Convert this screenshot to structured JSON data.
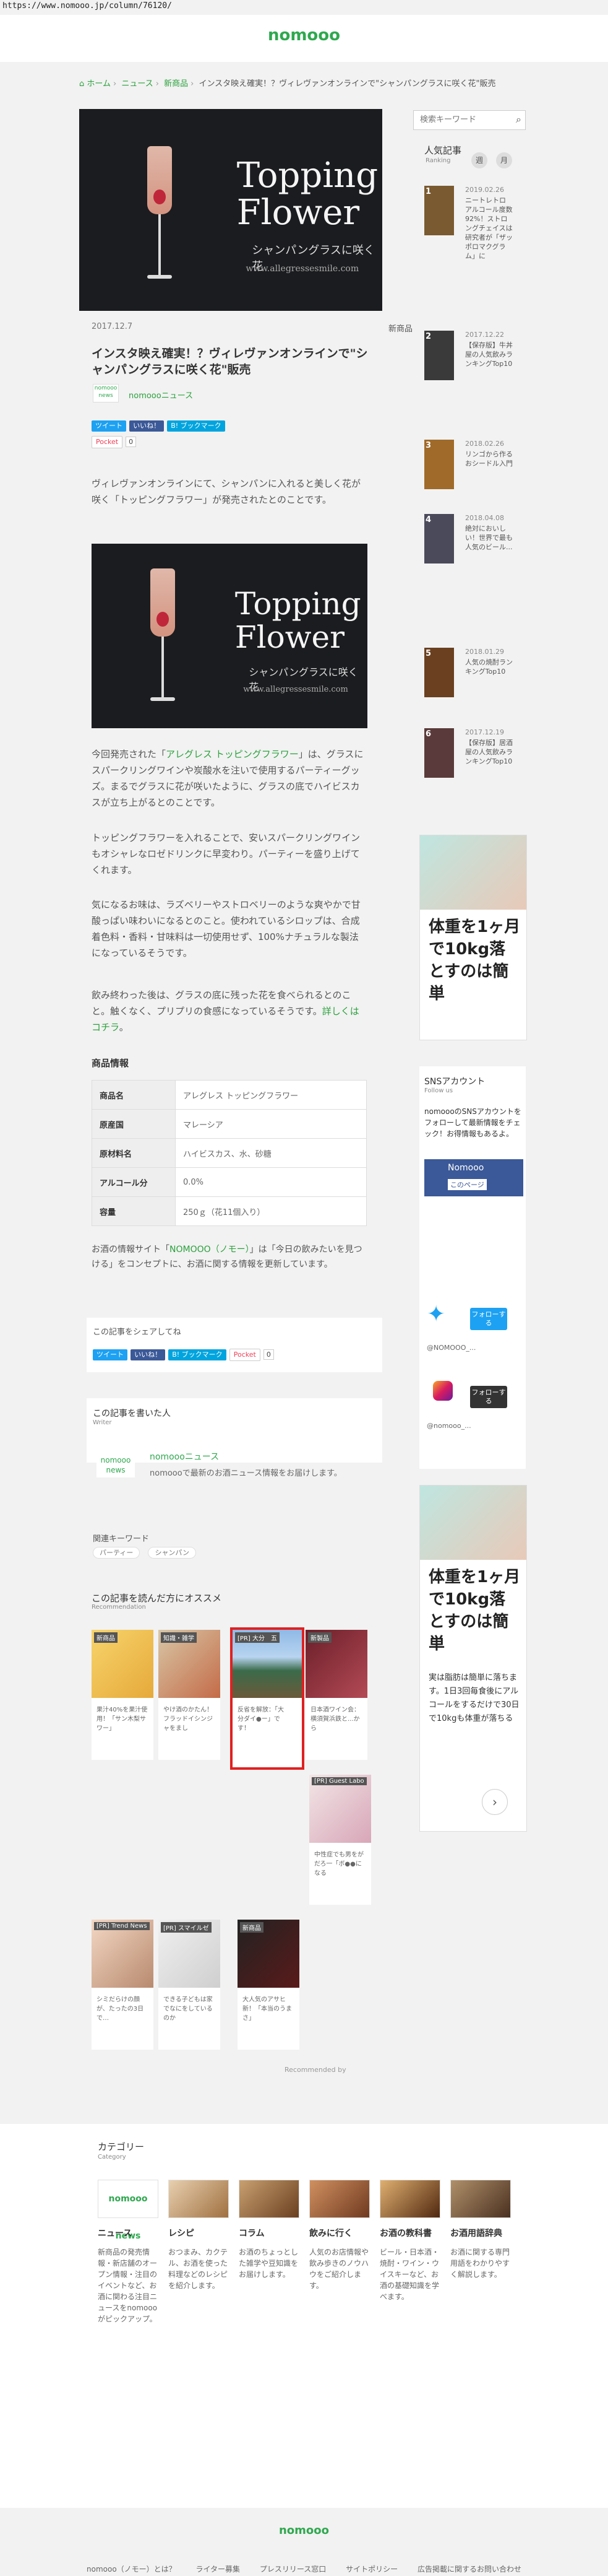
{
  "url": "https://www.nomooo.jp/column/76120/",
  "site": {
    "logo": "nomooo"
  },
  "breadcrumb": {
    "home": "ホーム",
    "news": "ニュース",
    "new": "新商品",
    "current": "インスタ映え確実！？ヴィレヴァンオンラインで\"シャンパングラスに咲く花\"販売"
  },
  "hero": {
    "title_line1": "Topping",
    "title_line2": "Flower",
    "subtitle": "シャンパングラスに咲く花",
    "watermark": "www.allegressesmile.com"
  },
  "article": {
    "date": "2017.12.7",
    "tag": "新商品",
    "title": "インスタ映え確実！？ヴィレヴァンオンラインで\"シャンパングラスに咲く花\"販売",
    "author": "nomoooニュース",
    "author_logo": "nomooo news",
    "lead": "ヴィレヴァンオンラインにて、シャンパンに入れると美しく花が咲く「トッピングフラワー」が発売されたとのことです。",
    "body1_pre": "今回発売された「",
    "body1_link": "アレグレス トッピングフラワー",
    "body1_post": "」は、グラスにスパークリングワインや炭酸水を注いで使用するパーティーグッズ。まるでグラスに花が咲いたように、グラスの底でハイビスカスが立ち上がるとのことです。",
    "body2": "トッピングフラワーを入れることで、安いスパークリングワインもオシャレなロゼドリンクに早変わり。パーティーを盛り上げてくれます。",
    "body3": "気になるお味は、ラズベリーやストロベリーのような爽やかで甘酸っぱい味わいになるとのこと。使われているシロップは、合成着色料・香料・甘味料は一切使用せず、100%ナチュラルな製法になっているそうです。",
    "body4_pre": "飲み終わった後は、グラスの底に残った花を食べられるとのこと。触くなく、プリプリの食感になっているそうです。",
    "body4_link": "詳しくはコチラ",
    "body4_post": "。"
  },
  "share": {
    "tweet": "ツイート",
    "like": "いいね！",
    "hatena": "B! ブックマーク",
    "pocket": "Pocket",
    "pocket_count": "0"
  },
  "product": {
    "heading": "商品情報",
    "rows": [
      {
        "key": "商品名",
        "value": "アレグレス トッピングフラワー"
      },
      {
        "key": "原産国",
        "value": "マレーシア"
      },
      {
        "key": "原材料名",
        "value": "ハイビスカス、水、砂糖"
      },
      {
        "key": "アルコール分",
        "value": "0.0%"
      },
      {
        "key": "容量",
        "value": "250ｇ（花11個入り）"
      }
    ]
  },
  "closing": {
    "pre": "お酒の情報サイト「",
    "link": "NOMOOO（ノモー）",
    "post": "」は「今日の飲みたいを見つける」をコンセプトに、お酒に関する情報を更新しています。"
  },
  "share_box": {
    "label": "この記事をシェアしてね"
  },
  "writer": {
    "title": "この記事を書いた人",
    "sub": "Writer",
    "name": "nomoooニュース",
    "desc": "nomoooで最新のお酒ニュース情報をお届けします。"
  },
  "related": {
    "heading": "関連キーワード",
    "keywords": [
      "パーティー",
      "シャンパン"
    ]
  },
  "recommend": {
    "title": "この記事を読んだ方にオススメ",
    "sub": "Recommendation",
    "cards": [
      {
        "label": "新商品",
        "caption": "果汁40%を果汁使用！「サン木梨サワー」"
      },
      {
        "label": "知識・雑学",
        "caption": "やけ酒のかたん！フラッドイシンジャをまし"
      },
      {
        "label": "[PR] 大分　五",
        "caption": "反省を解放：「大分ダイ●ー」です！"
      },
      {
        "label": "新製品",
        "caption": "日本酒ワイン会：横須賀浜鉄と...から"
      },
      {
        "label": "[PR] Guest Labo",
        "caption": "中性症でも男をがだろ一「ボ●●になる"
      },
      {
        "label": "[PR] Trend News",
        "caption": "シミだらけの顔が、たったの3日で…"
      },
      {
        "label": "[PR] スマイルゼ",
        "caption": "できる子どもは家でなにをしているのか"
      },
      {
        "label": "新商品",
        "caption": "大人気のアサヒ新！「本当のうまさ」"
      }
    ],
    "footer": "Recommended by"
  },
  "sidebar": {
    "search_placeholder": "検索キーワード",
    "ranking_title": "人気記事",
    "ranking_sub": "Ranking",
    "tabs": [
      "週",
      "月"
    ],
    "ranking": [
      {
        "num": "1",
        "date": "2019.02.26",
        "title": "ニートレトロ アルコール度数92%！ストロングチェイスは研究者が「ザッポロマクグラム」に"
      },
      {
        "num": "2",
        "date": "2017.12.22",
        "title": "【保存版】牛丼屋の人気飲みランキングTop10"
      },
      {
        "num": "3",
        "date": "2018.02.26",
        "title": "リンゴから作るおシードル入門"
      },
      {
        "num": "4",
        "date": "2018.04.08",
        "title": "絶対においしい！世界で最も人気のビール..."
      },
      {
        "num": "5",
        "date": "2018.01.29",
        "title": "人気の焼酎ランキングTop10"
      },
      {
        "num": "6",
        "date": "2017.12.19",
        "title": "【保存版】居酒屋の人気飲みランキングTop10"
      }
    ],
    "ad1": {
      "headline": "体重を1ヶ月で10kg落とすのは簡単"
    },
    "sns": {
      "title": "SNSアカウント",
      "sub": "Follow us",
      "desc": "nomoooのSNSアカウントをフォローして最新情報をチェック！お得情報もあるよ。",
      "fb_page": "Nomooo",
      "fb_like": "このページ",
      "twitter_name": "@NOMOOO_...",
      "instagram_name": "@nomooo_...",
      "follow": "フォローする"
    },
    "ad2": {
      "headline": "体重を1ヶ月で10kg落とすのは簡単",
      "desc": "実は脂肪は簡単に落ちます。1日3回毎食後にアルコールをするだけで30日で10kgも体重が落ちる"
    }
  },
  "categories": {
    "title": "カテゴリー",
    "sub": "Category",
    "items": [
      {
        "name": "ニュース",
        "desc": "新商品の発売情報・新店舗のオープン情報・注目のイベントなど、お酒に関わる注目ニュースをnomoooがピックアップ。"
      },
      {
        "name": "レシピ",
        "desc": "おつまみ、カクテル、お酒を使った料理などのレシピを紹介します。"
      },
      {
        "name": "コラム",
        "desc": "お酒のちょっとした雑学や豆知識をお届けします。"
      },
      {
        "name": "飲みに行く",
        "desc": "人気のお店情報や飲み歩きのノウハウをご紹介します。"
      },
      {
        "name": "お酒の教科書",
        "desc": "ビール・日本酒・焼酎・ワイン・ウイスキーなど、お酒の基礎知識を学べます。"
      },
      {
        "name": "お酒用語辞典",
        "desc": "お酒に関する専門用語をわかりやすく解説します。"
      }
    ]
  },
  "footer": {
    "logo": "nomooo",
    "links": [
      "nomooo（ノモー）とは？",
      "ライター募集",
      "プレスリリース窓口",
      "サイトポリシー",
      "広告掲載に関するお問い合わせ"
    ]
  }
}
